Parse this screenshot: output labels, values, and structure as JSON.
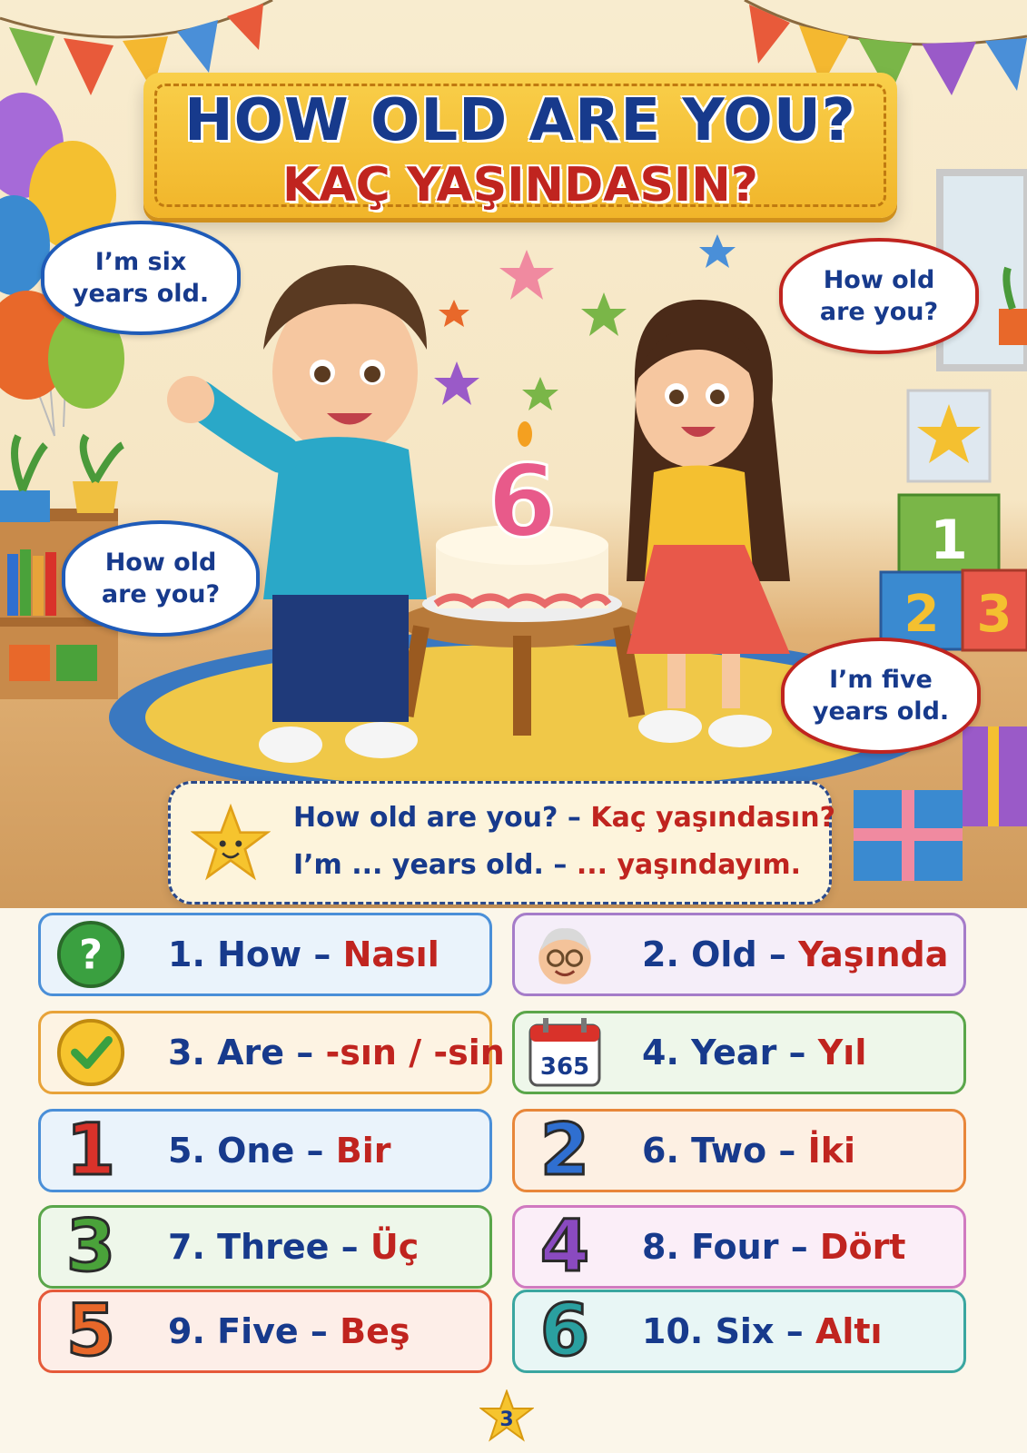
{
  "title": {
    "english": "HOW OLD ARE YOU?",
    "turkish": "KAÇ YAŞINDASIN?"
  },
  "bubbles": {
    "boy_answer": [
      "I’m six",
      "years old."
    ],
    "girl_question": [
      "How old",
      "are you?"
    ],
    "boy_question": [
      "How old",
      "are you?"
    ],
    "girl_answer": [
      "I’m five",
      "years old."
    ]
  },
  "cake_number": "6",
  "blocks": [
    "1",
    "2",
    "3"
  ],
  "phrases": [
    {
      "en": "How old are you? –",
      "tr": "Kaç yaşındasın?"
    },
    {
      "en": "I’m ... years old. –",
      "tr": "... yaşındayım."
    }
  ],
  "vocabulary": [
    {
      "num": "1.",
      "en": "How",
      "tr": "Nasıl",
      "icon": "question-mark-icon",
      "color": "#4a8fd8",
      "bg": "#eaf3fb"
    },
    {
      "num": "2.",
      "en": "Old",
      "tr": "Yaşında",
      "icon": "grandpa-face-icon",
      "color": "#a57cc9",
      "bg": "#f5eef9"
    },
    {
      "num": "3.",
      "en": "Are",
      "tr": "-sın / -sin",
      "icon": "checkmark-icon",
      "color": "#e8a33a",
      "bg": "#fdf3e3"
    },
    {
      "num": "4.",
      "en": "Year",
      "tr": "Yıl",
      "icon": "calendar-icon",
      "icon_text": "365",
      "color": "#5aa64a",
      "bg": "#eef7ea"
    },
    {
      "num": "5.",
      "en": "One",
      "tr": "Bir",
      "icon": "number-one-icon",
      "icon_text": "1",
      "color": "#4a8fd8",
      "bg": "#eaf3fb"
    },
    {
      "num": "6.",
      "en": "Two",
      "tr": "İki",
      "icon": "number-two-icon",
      "icon_text": "2",
      "color": "#e8873a",
      "bg": "#fdf0e3"
    },
    {
      "num": "7.",
      "en": "Three",
      "tr": "Üç",
      "icon": "number-three-icon",
      "icon_text": "3",
      "color": "#5aa64a",
      "bg": "#eef7ea"
    },
    {
      "num": "8.",
      "en": "Four",
      "tr": "Dört",
      "icon": "number-four-icon",
      "icon_text": "4",
      "color": "#d07ac0",
      "bg": "#fbeef8"
    },
    {
      "num": "9.",
      "en": "Five",
      "tr": "Beş",
      "icon": "number-five-icon",
      "icon_text": "5",
      "color": "#e55a3a",
      "bg": "#fdeee8"
    },
    {
      "num": "10.",
      "en": "Six",
      "tr": "Altı",
      "icon": "number-six-icon",
      "icon_text": "6",
      "color": "#3aa6a0",
      "bg": "#e8f6f5"
    }
  ],
  "number_colors": [
    "#d9322a",
    "#2f6fd0",
    "#4aa23a",
    "#8a4ac0",
    "#e8682a",
    "#2aa0a0"
  ],
  "page_number": "3"
}
